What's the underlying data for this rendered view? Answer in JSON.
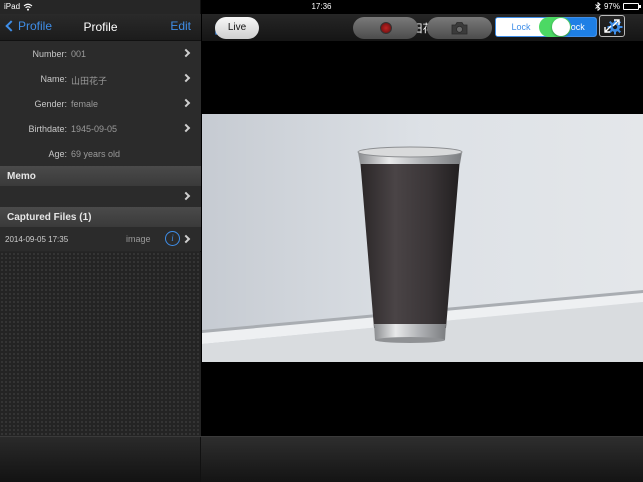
{
  "status_bar": {
    "device": "iPad",
    "time": "17:36",
    "battery": "97%",
    "battery_level": 0.97
  },
  "sidebar": {
    "back_label": "Profile",
    "title": "Profile",
    "edit_label": "Edit",
    "fields": [
      {
        "label": "Number:",
        "value": "001"
      },
      {
        "label": "Name:",
        "value": "山田花子"
      },
      {
        "label": "Gender:",
        "value": "female"
      },
      {
        "label": "Birthdate:",
        "value": "1945-09-05"
      },
      {
        "label": "Age:",
        "value": "69 years old"
      }
    ],
    "memo_header": "Memo",
    "captured_header": "Captured Files (1)",
    "files": [
      {
        "date": "2014-09-05 17:35",
        "type": "image"
      }
    ]
  },
  "main": {
    "title": "山田花子",
    "lock_label": "Lock",
    "unlock_label": "Unlock",
    "selected_segment": "Unlock"
  },
  "toolbar": {
    "live_label": "Live",
    "toggle_on": true
  },
  "icons": {
    "wifi": "wifi-icon",
    "bluetooth": "bluetooth-icon",
    "share": "share-icon",
    "gear": "gear-icon",
    "info": "info-icon",
    "record": "record-icon",
    "camera": "camera-icon",
    "fullscreen": "fullscreen-icon"
  },
  "colors": {
    "accent": "#1e7fe5",
    "toggle_on": "#4cd964"
  }
}
